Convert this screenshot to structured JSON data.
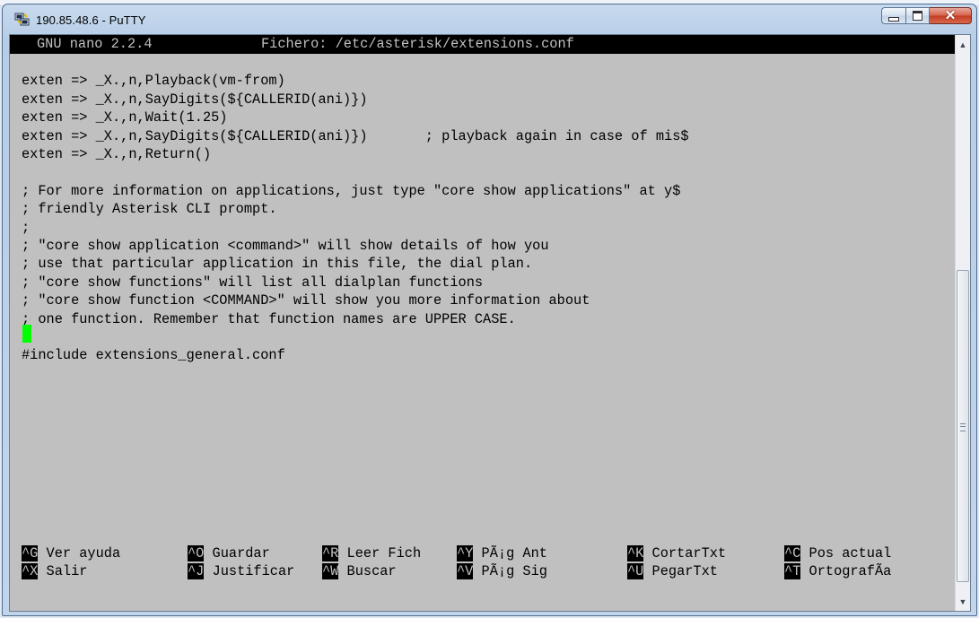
{
  "window": {
    "title": "190.85.48.6 - PuTTY",
    "icon": "putty-icon",
    "controls": {
      "minimize": "minimize-icon",
      "maximize": "maximize-icon",
      "close": "✕"
    }
  },
  "nano": {
    "version": "GNU nano 2.2.4",
    "file_label": "Fichero: /etc/asterisk/extensions.conf"
  },
  "lines": [
    "",
    "exten => _X.,n,Playback(vm-from)",
    "exten => _X.,n,SayDigits(${CALLERID(ani)})",
    "exten => _X.,n,Wait(1.25)",
    "exten => _X.,n,SayDigits(${CALLERID(ani)})       ; playback again in case of mis$",
    "exten => _X.,n,Return()",
    "",
    "; For more information on applications, just type \"core show applications\" at y$",
    "; friendly Asterisk CLI prompt.",
    ";",
    "; \"core show application <command>\" will show details of how you",
    "; use that particular application in this file, the dial plan.",
    "; \"core show functions\" will list all dialplan functions",
    "; \"core show function <COMMAND>\" will show you more information about",
    "; one function. Remember that function names are UPPER CASE.",
    "",
    "#include extensions_general.conf"
  ],
  "shortcuts": [
    [
      {
        "key": "^G",
        "label": " Ver ayuda"
      },
      {
        "key": "^O",
        "label": " Guardar"
      },
      {
        "key": "^R",
        "label": " Leer Fich"
      },
      {
        "key": "^Y",
        "label": " PÃ¡g Ant"
      },
      {
        "key": "^K",
        "label": " CortarTxt"
      },
      {
        "key": "^C",
        "label": " Pos actual"
      }
    ],
    [
      {
        "key": "^X",
        "label": " Salir"
      },
      {
        "key": "^J",
        "label": " Justificar"
      },
      {
        "key": "^W",
        "label": " Buscar"
      },
      {
        "key": "^V",
        "label": " PÃ¡g Sig"
      },
      {
        "key": "^U",
        "label": " PegarTxt"
      },
      {
        "key": "^T",
        "label": " OrtografÃ­a"
      }
    ]
  ],
  "colors": {
    "terminal_bg": "#c0c0c0",
    "terminal_fg": "#000000",
    "cursor": "#00ff00",
    "inverse_bg": "#000000"
  }
}
